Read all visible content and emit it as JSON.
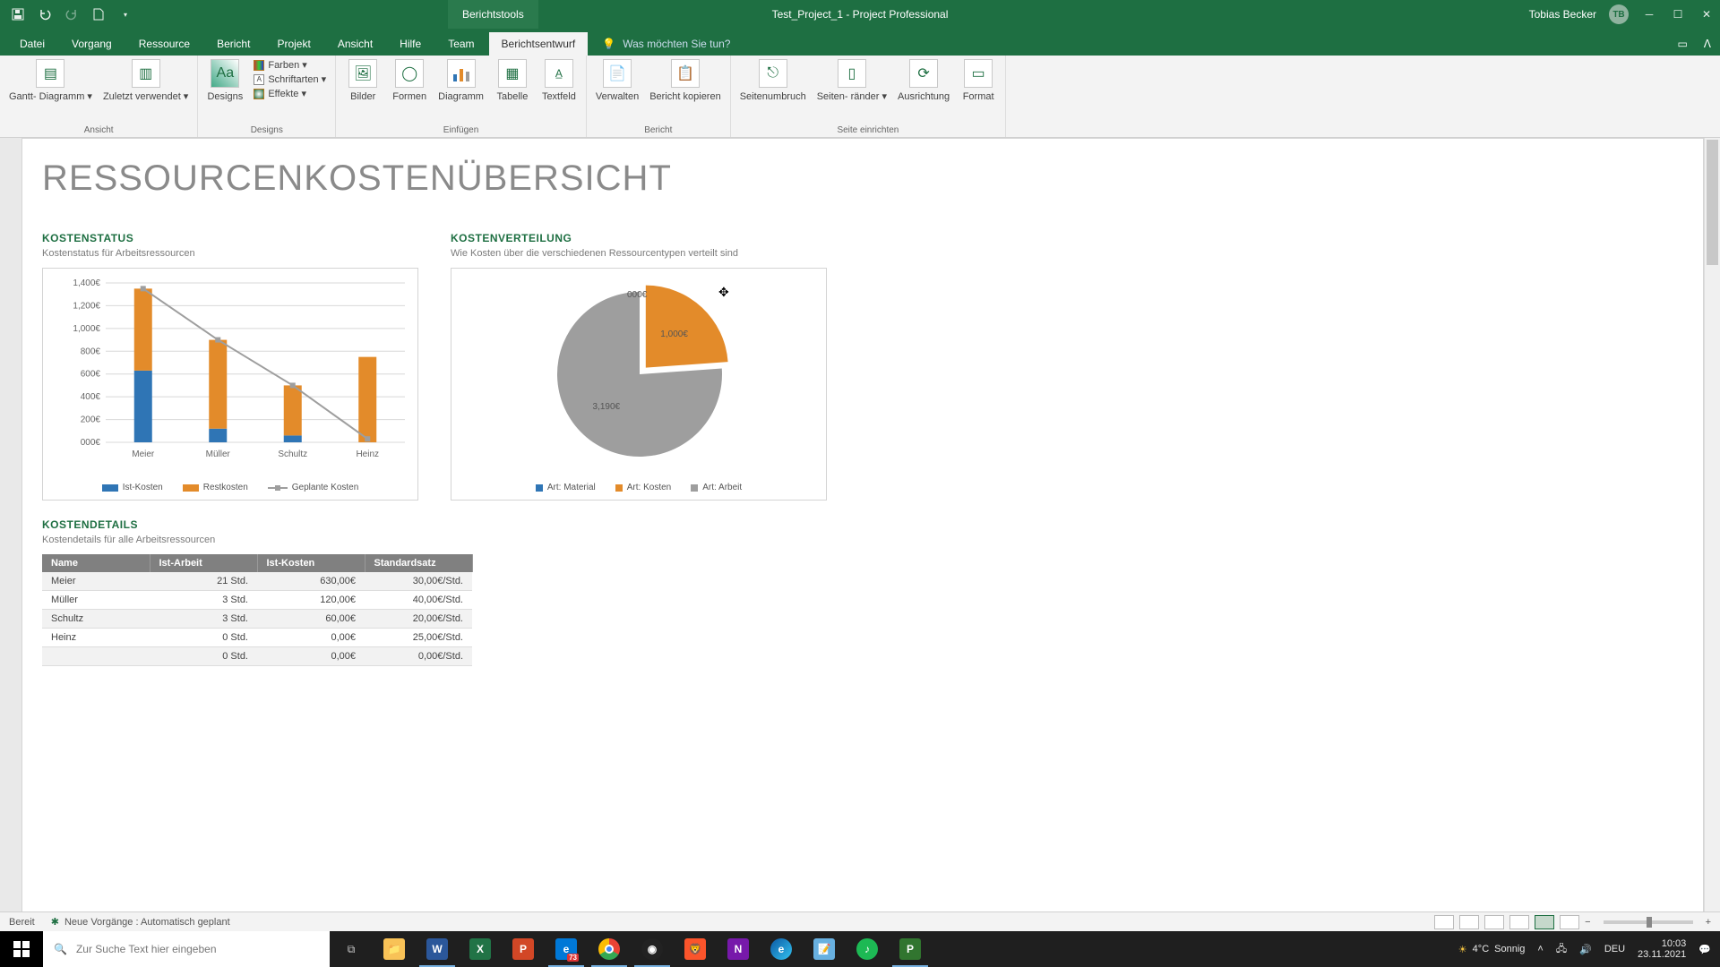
{
  "title_bar": {
    "context_tab": "Berichtstools",
    "doc_title": "Test_Project_1  -  Project Professional",
    "user_name": "Tobias Becker",
    "user_initials": "TB"
  },
  "tabs": {
    "datei": "Datei",
    "vorgang": "Vorgang",
    "ressource": "Ressource",
    "bericht": "Bericht",
    "projekt": "Projekt",
    "ansicht": "Ansicht",
    "hilfe": "Hilfe",
    "team": "Team",
    "berichtsentwurf": "Berichtsentwurf",
    "tellme": "Was möchten Sie tun?"
  },
  "ribbon": {
    "ansicht": {
      "gantt": "Gantt-\nDiagramm ▾",
      "zuletzt": "Zuletzt\nverwendet ▾",
      "group": "Ansicht"
    },
    "designs": {
      "designs": "Designs",
      "farben": "Farben ▾",
      "schriftarten": "Schriftarten ▾",
      "effekte": "Effekte ▾",
      "group": "Designs"
    },
    "einfuegen": {
      "bilder": "Bilder",
      "formen": "Formen",
      "diagramm": "Diagramm",
      "tabelle": "Tabelle",
      "textfeld": "Textfeld",
      "group": "Einfügen"
    },
    "bericht": {
      "verwalten": "Verwalten",
      "kopieren": "Bericht\nkopieren",
      "group": "Bericht"
    },
    "seite": {
      "umbruch": "Seitenumbruch",
      "raender": "Seiten-\nränder ▾",
      "ausrichtung": "Ausrichtung",
      "format": "Format",
      "group": "Seite einrichten"
    }
  },
  "side_label": "RESSOURCENKOSTEN ÜBERSICHT",
  "report": {
    "title": "RESSOURCENKOSTENÜBERSICHT",
    "status": {
      "title": "KOSTENSTATUS",
      "sub": "Kostenstatus für Arbeitsressourcen"
    },
    "verteilung": {
      "title": "KOSTENVERTEILUNG",
      "sub": "Wie Kosten über die verschiedenen Ressourcentypen verteilt sind"
    },
    "details": {
      "title": "KOSTENDETAILS",
      "sub": "Kostendetails für alle Arbeitsressourcen"
    }
  },
  "chart_data": [
    {
      "id": "bar",
      "type": "bar",
      "title": "Kostenstatus",
      "categories": [
        "Meier",
        "Müller",
        "Schultz",
        "Heinz"
      ],
      "yticks": [
        "000€",
        "200€",
        "400€",
        "600€",
        "800€",
        "1,000€",
        "1,200€",
        "1,400€"
      ],
      "series": [
        {
          "name": "Ist-Kosten",
          "color": "#2f75b5",
          "values": [
            630,
            120,
            60,
            0
          ]
        },
        {
          "name": "Restkosten",
          "color": "#e38b2a",
          "values": [
            720,
            780,
            440,
            750
          ]
        },
        {
          "name": "Geplante Kosten",
          "color": "#9e9e9e",
          "type": "line",
          "values": [
            1350,
            900,
            500,
            30
          ]
        }
      ],
      "ylim": [
        0,
        1400
      ]
    },
    {
      "id": "pie",
      "type": "pie",
      "title": "Kostenverteilung",
      "slices": [
        {
          "name": "Art: Material",
          "color": "#2f75b5",
          "value": 0,
          "label": "000€"
        },
        {
          "name": "Art: Kosten",
          "color": "#e38b2a",
          "value": 1000,
          "label": "1,000€"
        },
        {
          "name": "Art: Arbeit",
          "color": "#9e9e9e",
          "value": 3190,
          "label": "3,190€"
        }
      ]
    }
  ],
  "table": {
    "headers": {
      "name": "Name",
      "ist_arbeit": "Ist-Arbeit",
      "ist_kosten": "Ist-Kosten",
      "satz": "Standardsatz"
    },
    "rows": [
      {
        "name": "Meier",
        "ist_arbeit": "21 Std.",
        "ist_kosten": "630,00€",
        "satz": "30,00€/Std."
      },
      {
        "name": "Müller",
        "ist_arbeit": "3 Std.",
        "ist_kosten": "120,00€",
        "satz": "40,00€/Std."
      },
      {
        "name": "Schultz",
        "ist_arbeit": "3 Std.",
        "ist_kosten": "60,00€",
        "satz": "20,00€/Std."
      },
      {
        "name": "Heinz",
        "ist_arbeit": "0 Std.",
        "ist_kosten": "0,00€",
        "satz": "25,00€/Std."
      },
      {
        "name": "",
        "ist_arbeit": "0 Std.",
        "ist_kosten": "0,00€",
        "satz": "0,00€/Std."
      }
    ]
  },
  "statusbar": {
    "ready": "Bereit",
    "sched": "Neue Vorgänge : Automatisch geplant"
  },
  "taskbar": {
    "search_placeholder": "Zur Suche Text hier eingeben",
    "weather_temp": "4°C",
    "weather_desc": "Sonnig",
    "lang": "DEU",
    "time": "10:03",
    "date": "23.11.2021",
    "chrome_badge": "73"
  }
}
